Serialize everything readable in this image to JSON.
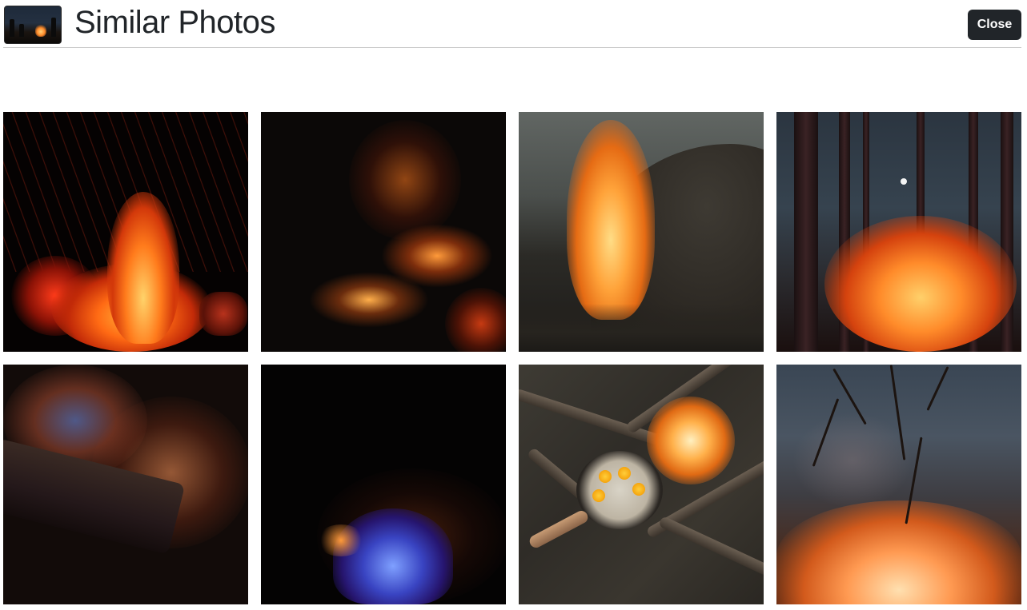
{
  "header": {
    "title": "Similar Photos",
    "close_label": "Close"
  },
  "grid": {
    "photos": [
      {
        "name": "photo-fire-sparks",
        "subject": "campfire with flying sparks"
      },
      {
        "name": "photo-embers",
        "subject": "glowing embers on dark background"
      },
      {
        "name": "photo-flame-rocks",
        "subject": "flame on rocks with gray sky"
      },
      {
        "name": "photo-forest-fire",
        "subject": "campfire in night forest"
      },
      {
        "name": "photo-sparks-log",
        "subject": "sparks over burning log"
      },
      {
        "name": "photo-blue-flame",
        "subject": "blue flame with embers"
      },
      {
        "name": "photo-skillet",
        "subject": "skillet with eggs over campfire"
      },
      {
        "name": "photo-branches-fire",
        "subject": "branches over blurred fire"
      }
    ]
  }
}
